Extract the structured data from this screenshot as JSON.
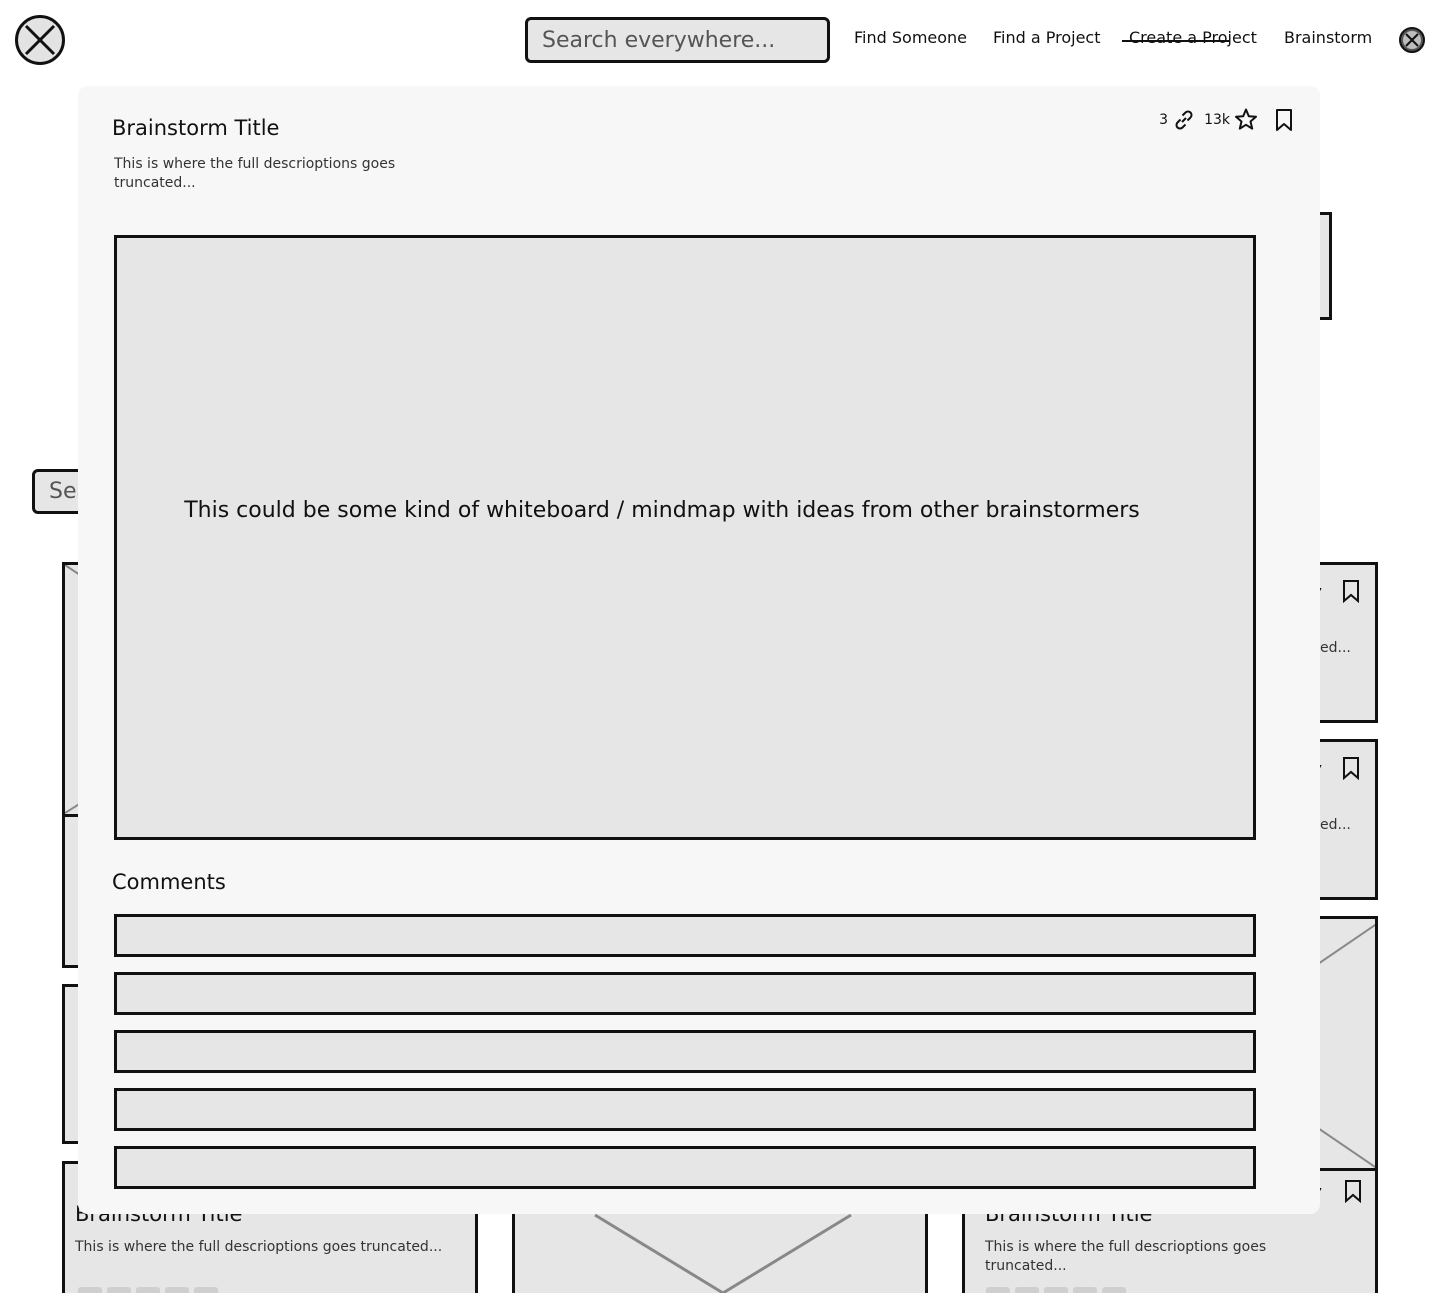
{
  "header": {
    "search_placeholder": "Search everywhere...",
    "nav": {
      "find_someone": "Find Someone",
      "find_project": "Find a Project",
      "create_project": "Create a Project",
      "brainstorm": "Brainstorm"
    }
  },
  "background": {
    "search_fragment": "Sea",
    "cards": [
      {
        "title": "Brainstorm Title",
        "description": "This is where the full descrioptions goes truncated..."
      },
      {
        "title": "Brainstorm Title",
        "description": "This is where the full descrioptions goes truncated..."
      }
    ],
    "desc_fragments": [
      "ed...",
      "ed..."
    ]
  },
  "modal": {
    "title": "Brainstorm Title",
    "description": "This is where the full descrioptions goes truncated...",
    "links_count": "3",
    "stars_count": "13k",
    "whiteboard_text": "This could be some kind of whiteboard / mindmap with ideas from other brainstormers",
    "comments_heading": "Comments",
    "comments": [
      "",
      "",
      "",
      "",
      ""
    ]
  },
  "icons": {
    "logo": "logo-placeholder-icon",
    "close": "close-icon",
    "link": "link-icon",
    "star": "star-icon",
    "bookmark": "bookmark-icon"
  }
}
